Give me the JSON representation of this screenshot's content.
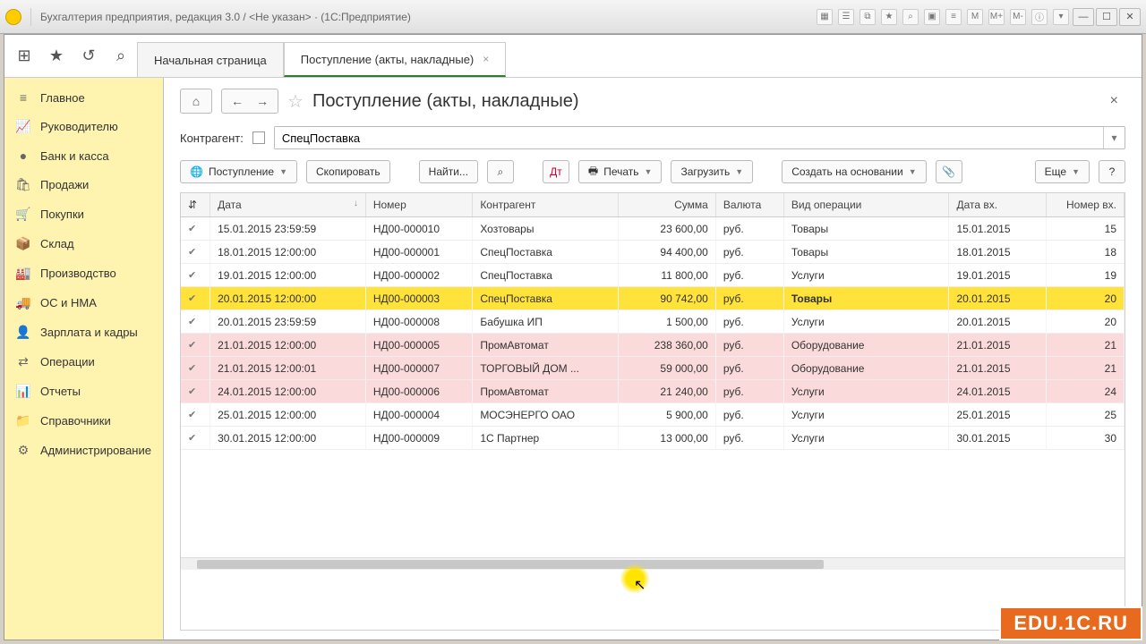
{
  "window": {
    "title": "Бухгалтерия предприятия, редакция 3.0 / <Не указан> · (1С:Предприятие)",
    "toolbar_letters": [
      "M",
      "M+",
      "M-"
    ]
  },
  "tabs": {
    "home": "Начальная страница",
    "active": "Поступление (акты, накладные)"
  },
  "sidebar": [
    {
      "icon": "≡",
      "label": "Главное",
      "name": "main"
    },
    {
      "icon": "📈",
      "label": "Руководителю",
      "name": "manager"
    },
    {
      "icon": "●",
      "label": "Банк и касса",
      "name": "bank"
    },
    {
      "icon": "🛍",
      "label": "Продажи",
      "name": "sales"
    },
    {
      "icon": "🛒",
      "label": "Покупки",
      "name": "purchases"
    },
    {
      "icon": "📦",
      "label": "Склад",
      "name": "warehouse"
    },
    {
      "icon": "🏭",
      "label": "Производство",
      "name": "production"
    },
    {
      "icon": "🚚",
      "label": "ОС и НМА",
      "name": "assets"
    },
    {
      "icon": "👤",
      "label": "Зарплата и кадры",
      "name": "hr"
    },
    {
      "icon": "⇄",
      "label": "Операции",
      "name": "operations"
    },
    {
      "icon": "📊",
      "label": "Отчеты",
      "name": "reports"
    },
    {
      "icon": "📁",
      "label": "Справочники",
      "name": "refs"
    },
    {
      "icon": "⚙",
      "label": "Администрирование",
      "name": "admin"
    }
  ],
  "page": {
    "title": "Поступление (акты, накладные)",
    "filter_label": "Контрагент:",
    "filter_value": "СпецПоставка"
  },
  "toolbar": {
    "receipt": "Поступление",
    "copy": "Скопировать",
    "find": "Найти...",
    "print": "Печать",
    "load": "Загрузить",
    "create_based": "Создать на основании",
    "more": "Еще",
    "help": "?"
  },
  "columns": {
    "c0": "⇵",
    "c1": "Дата",
    "c2": "Номер",
    "c3": "Контрагент",
    "c4": "Сумма",
    "c5": "Валюта",
    "c6": "Вид операции",
    "c7": "Дата вх.",
    "c8": "Номер вх.",
    "sort": "↓"
  },
  "rows": [
    {
      "date": "15.01.2015 23:59:59",
      "num": "НД00-000010",
      "contr": "Хозтовары",
      "sum": "23 600,00",
      "cur": "руб.",
      "op": "Товары",
      "din": "15.01.2015",
      "nin": "15",
      "sel": false,
      "pink": false
    },
    {
      "date": "18.01.2015 12:00:00",
      "num": "НД00-000001",
      "contr": "СпецПоставка",
      "sum": "94 400,00",
      "cur": "руб.",
      "op": "Товары",
      "din": "18.01.2015",
      "nin": "18",
      "sel": false,
      "pink": false
    },
    {
      "date": "19.01.2015 12:00:00",
      "num": "НД00-000002",
      "contr": "СпецПоставка",
      "sum": "11 800,00",
      "cur": "руб.",
      "op": "Услуги",
      "din": "19.01.2015",
      "nin": "19",
      "sel": false,
      "pink": false
    },
    {
      "date": "20.01.2015 12:00:00",
      "num": "НД00-000003",
      "contr": "СпецПоставка",
      "sum": "90 742,00",
      "cur": "руб.",
      "op": "Товары",
      "din": "20.01.2015",
      "nin": "20",
      "sel": true,
      "pink": false
    },
    {
      "date": "20.01.2015 23:59:59",
      "num": "НД00-000008",
      "contr": "Бабушка ИП",
      "sum": "1 500,00",
      "cur": "руб.",
      "op": "Услуги",
      "din": "20.01.2015",
      "nin": "20",
      "sel": false,
      "pink": false
    },
    {
      "date": "21.01.2015 12:00:00",
      "num": "НД00-000005",
      "contr": "ПромАвтомат",
      "sum": "238 360,00",
      "cur": "руб.",
      "op": "Оборудование",
      "din": "21.01.2015",
      "nin": "21",
      "sel": false,
      "pink": true
    },
    {
      "date": "21.01.2015 12:00:01",
      "num": "НД00-000007",
      "contr": "ТОРГОВЫЙ ДОМ ...",
      "sum": "59 000,00",
      "cur": "руб.",
      "op": "Оборудование",
      "din": "21.01.2015",
      "nin": "21",
      "sel": false,
      "pink": true
    },
    {
      "date": "24.01.2015 12:00:00",
      "num": "НД00-000006",
      "contr": "ПромАвтомат",
      "sum": "21 240,00",
      "cur": "руб.",
      "op": "Услуги",
      "din": "24.01.2015",
      "nin": "24",
      "sel": false,
      "pink": true
    },
    {
      "date": "25.01.2015 12:00:00",
      "num": "НД00-000004",
      "contr": "МОСЭНЕРГО ОАО",
      "sum": "5 900,00",
      "cur": "руб.",
      "op": "Услуги",
      "din": "25.01.2015",
      "nin": "25",
      "sel": false,
      "pink": false
    },
    {
      "date": "30.01.2015 12:00:00",
      "num": "НД00-000009",
      "contr": "1С Партнер",
      "sum": "13 000,00",
      "cur": "руб.",
      "op": "Услуги",
      "din": "30.01.2015",
      "nin": "30",
      "sel": false,
      "pink": false
    }
  ],
  "watermark": "EDU.1C.RU"
}
